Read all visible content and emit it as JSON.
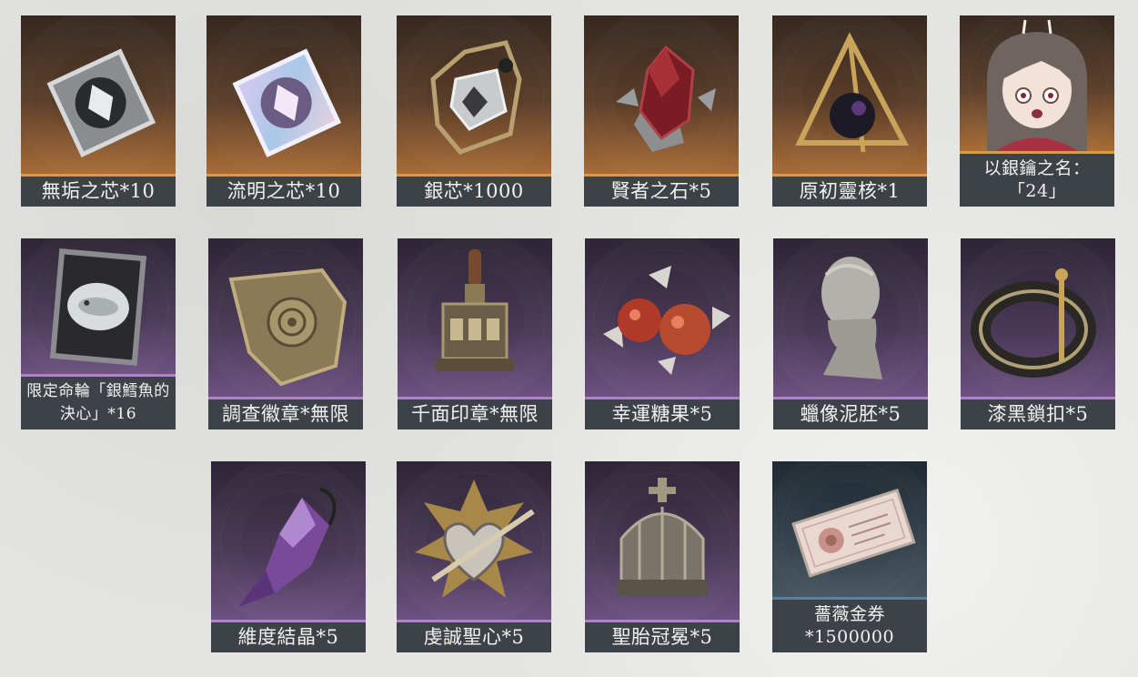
{
  "rows": [
    {
      "items": [
        {
          "name": "無垢之芯*10",
          "art": "silver-cube-icon"
        },
        {
          "name": "流明之芯*10",
          "art": "iridescent-cube-icon"
        },
        {
          "name": "銀芯*1000",
          "art": "silver-core-icon"
        },
        {
          "name": "賢者之石*5",
          "art": "red-crystal-icon"
        },
        {
          "name": "原初靈核*1",
          "art": "pyramid-core-icon"
        },
        {
          "name": "以銀鑰之名：「24」",
          "art": "character-portrait"
        }
      ]
    },
    {
      "items": [
        {
          "name": "限定命輪「銀鱈魚的決心」*16",
          "art": "framed-fish-card-icon"
        },
        {
          "name": "調查徽章*無限",
          "art": "rose-badge-icon"
        },
        {
          "name": "千面印章*無限",
          "art": "stamp-icon"
        },
        {
          "name": "幸運糖果*5",
          "art": "candy-icon"
        },
        {
          "name": "蠟像泥胚*5",
          "art": "bust-icon"
        },
        {
          "name": "漆黑鎖扣*5",
          "art": "shackle-icon"
        }
      ]
    },
    {
      "items": [
        {
          "name": "維度結晶*5",
          "art": "purple-crystal-icon"
        },
        {
          "name": "虔誠聖心*5",
          "art": "sacred-heart-icon"
        },
        {
          "name": "聖胎冠冕*5",
          "art": "crown-icon"
        },
        {
          "name": "薔薇金券*1500000",
          "art": "rose-ticket-icon"
        }
      ]
    }
  ],
  "colors": {
    "brown_tier": "#a86c37",
    "purple_tier": "#6d5180",
    "slate_tier": "#46555e",
    "label_bg": "#3d4249"
  }
}
